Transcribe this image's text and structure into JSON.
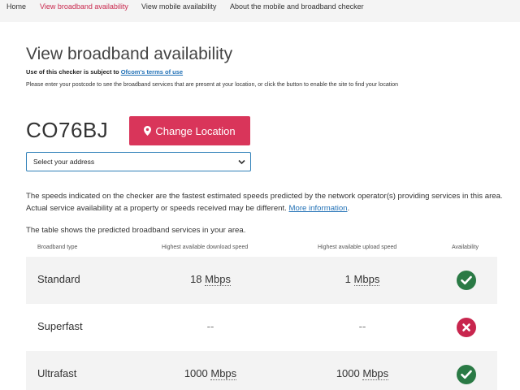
{
  "nav": {
    "items": [
      {
        "label": "Home",
        "active": false
      },
      {
        "label": "View broadband availability",
        "active": true
      },
      {
        "label": "View mobile availability",
        "active": false
      },
      {
        "label": "About the mobile and broadband checker",
        "active": false
      }
    ]
  },
  "page": {
    "title": "View broadband availability",
    "terms_prefix": "Use of this checker is subject to ",
    "terms_link": "Ofcom's terms of use",
    "instructions": "Please enter your postcode to see the broadband services that are present at your location, or click the button to enable the site to find your location"
  },
  "location": {
    "postcode": "CO76BJ",
    "change_button": "Change Location",
    "button_icon": "map-marker-icon",
    "address_select": "Select your address"
  },
  "info": {
    "speeds_note": "The speeds indicated on the checker are the fastest estimated speeds predicted by the network operator(s) providing services in this area. Actual service availability at a property or speeds received may be different. ",
    "more_info_link": "More information",
    "more_info_suffix": ".",
    "table_intro": "The table shows the predicted broadband services in your area."
  },
  "table": {
    "headers": [
      "Broadband type",
      "Highest available download speed",
      "Highest available upload speed",
      "Availability"
    ],
    "rows": [
      {
        "type": "Standard",
        "download": "18",
        "download_unit": "Mbps",
        "upload": "1",
        "upload_unit": "Mbps",
        "available": true
      },
      {
        "type": "Superfast",
        "download": "--",
        "download_unit": "",
        "upload": "--",
        "upload_unit": "",
        "available": false
      },
      {
        "type": "Ultrafast",
        "download": "1000",
        "download_unit": "Mbps",
        "upload": "1000",
        "upload_unit": "Mbps",
        "available": true
      }
    ]
  },
  "colors": {
    "accent": "#d9355a",
    "available": "#2a7a45",
    "unavailable": "#c8264e",
    "link": "#1f6fb5"
  }
}
